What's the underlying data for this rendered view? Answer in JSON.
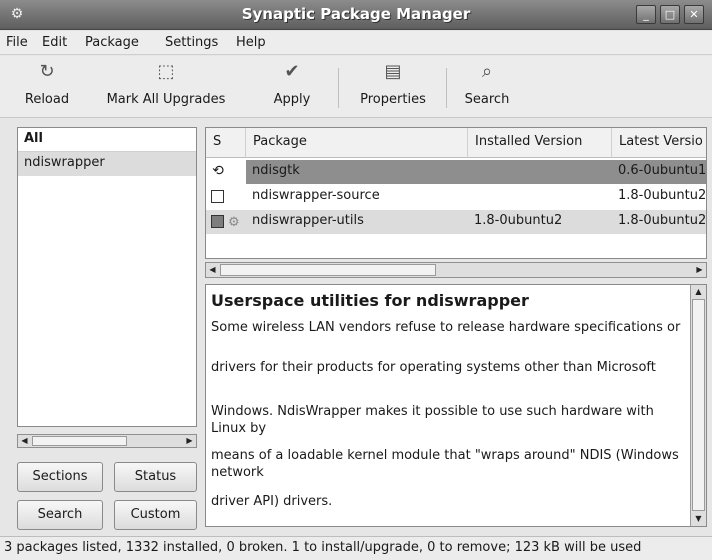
{
  "window": {
    "title": "Synaptic Package Manager",
    "app_icon": "synaptic-icon",
    "controls": [
      "minimize-icon",
      "maximize-icon",
      "close-icon"
    ]
  },
  "menubar": {
    "items": [
      {
        "label": "File"
      },
      {
        "label": "Edit"
      },
      {
        "label": "Package"
      },
      {
        "label": "Settings"
      },
      {
        "label": "Help"
      }
    ]
  },
  "toolbar": {
    "buttons": [
      {
        "label": "Reload",
        "icon": "reload-icon"
      },
      {
        "label": "Mark All Upgrades",
        "icon": "mark-upgrades-icon"
      },
      {
        "label": "Apply",
        "icon": "apply-checkmark-icon"
      },
      {
        "label": "Properties",
        "icon": "properties-icon"
      },
      {
        "label": "Search",
        "icon": "search-icon"
      }
    ]
  },
  "filter_list": {
    "header": "All",
    "items": [
      "ndiswrapper"
    ]
  },
  "left_buttons": {
    "sections": "Sections",
    "status": "Status",
    "search": "Search",
    "custom": "Custom"
  },
  "package_table": {
    "columns": [
      "S",
      "Package",
      "Installed Version",
      "Latest Versio"
    ],
    "rows": [
      {
        "status_icon": "upgrade-status-icon",
        "package": "ndisgtk",
        "installed": "",
        "latest": "0.6-0ubuntu1",
        "selected": true
      },
      {
        "status_icon": "not-installed-checkbox",
        "package": "ndiswrapper-source",
        "installed": "",
        "latest": "1.8-0ubuntu2",
        "selected": false
      },
      {
        "status_icon": "installed-checkbox",
        "package": "ndiswrapper-utils",
        "installed": "1.8-0ubuntu2",
        "latest": "1.8-0ubuntu2",
        "selected": false,
        "shaded": true
      }
    ]
  },
  "description": {
    "title": "Userspace utilities for ndiswrapper",
    "paragraphs": [
      "Some wireless LAN vendors refuse to release hardware specifications or",
      "drivers for their products for operating systems other than Microsoft",
      "Windows. NdisWrapper makes it possible to use such hardware with Linux by",
      "means of a loadable kernel module that \"wraps around\" NDIS (Windows network",
      "driver API) drivers."
    ]
  },
  "statusbar": {
    "text": "3 packages listed, 1332 installed, 0 broken. 1 to install/upgrade, 0 to remove; 123 kB will be used"
  },
  "colors": {
    "selected_row": "#8e8e8e",
    "shaded_row": "#dcdcdc",
    "titlebar": "#6e6e6e"
  }
}
